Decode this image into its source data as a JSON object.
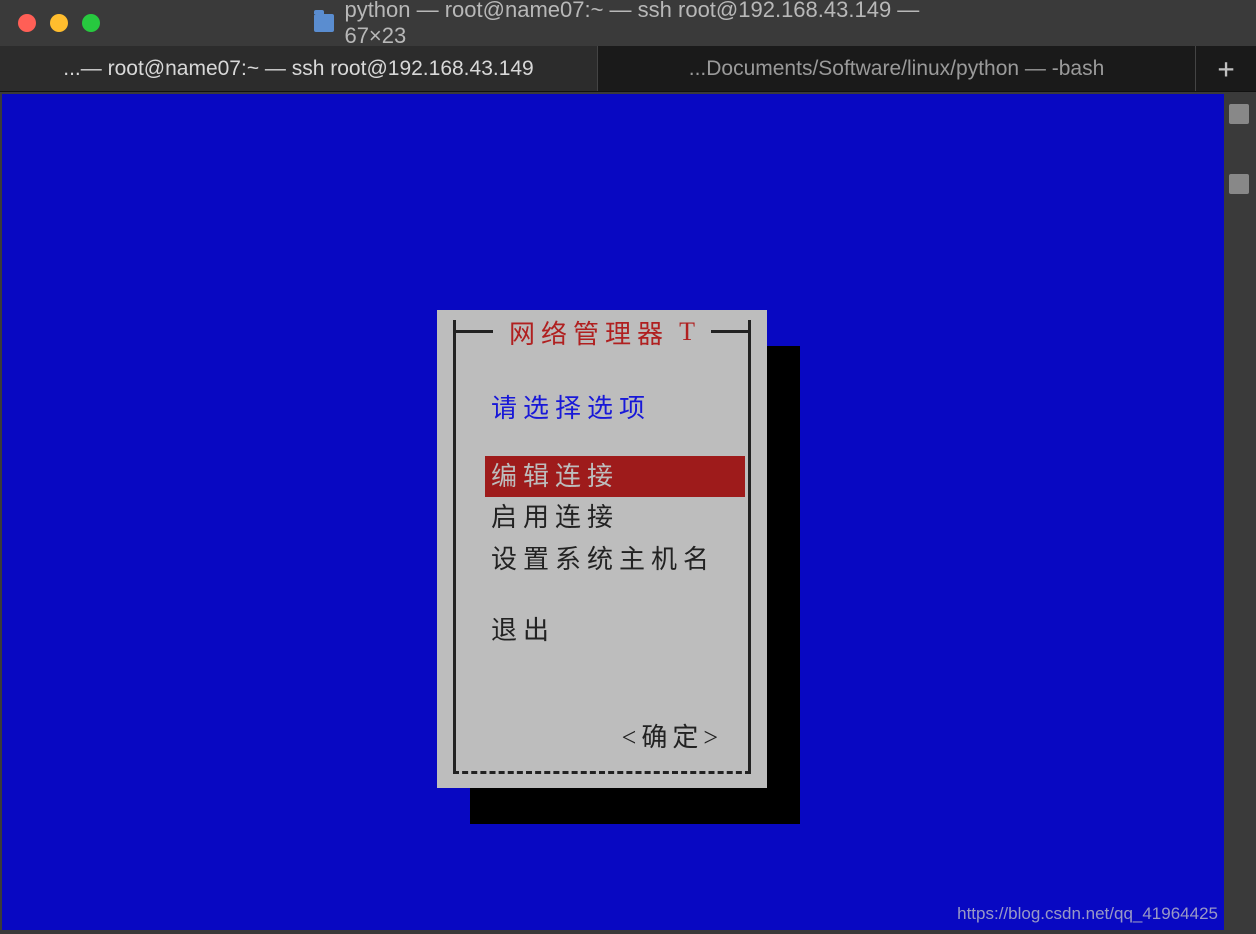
{
  "window": {
    "title": "python — root@name07:~ — ssh root@192.168.43.149 — 67×23"
  },
  "tabs": [
    {
      "label": "...— root@name07:~ — ssh root@192.168.43.149",
      "active": true
    },
    {
      "label": "...Documents/Software/linux/python — -bash",
      "active": false
    }
  ],
  "new_tab_label": "+",
  "dialog": {
    "title": "网络管理器",
    "title_suffix": "T",
    "prompt": "请选择选项",
    "items": [
      {
        "label": "编辑连接",
        "selected": true
      },
      {
        "label": "启用连接",
        "selected": false
      },
      {
        "label": "设置系统主机名",
        "selected": false
      }
    ],
    "exit_label": "退出",
    "ok_label": "<确定>"
  },
  "watermark": "https://blog.csdn.net/qq_41964425"
}
